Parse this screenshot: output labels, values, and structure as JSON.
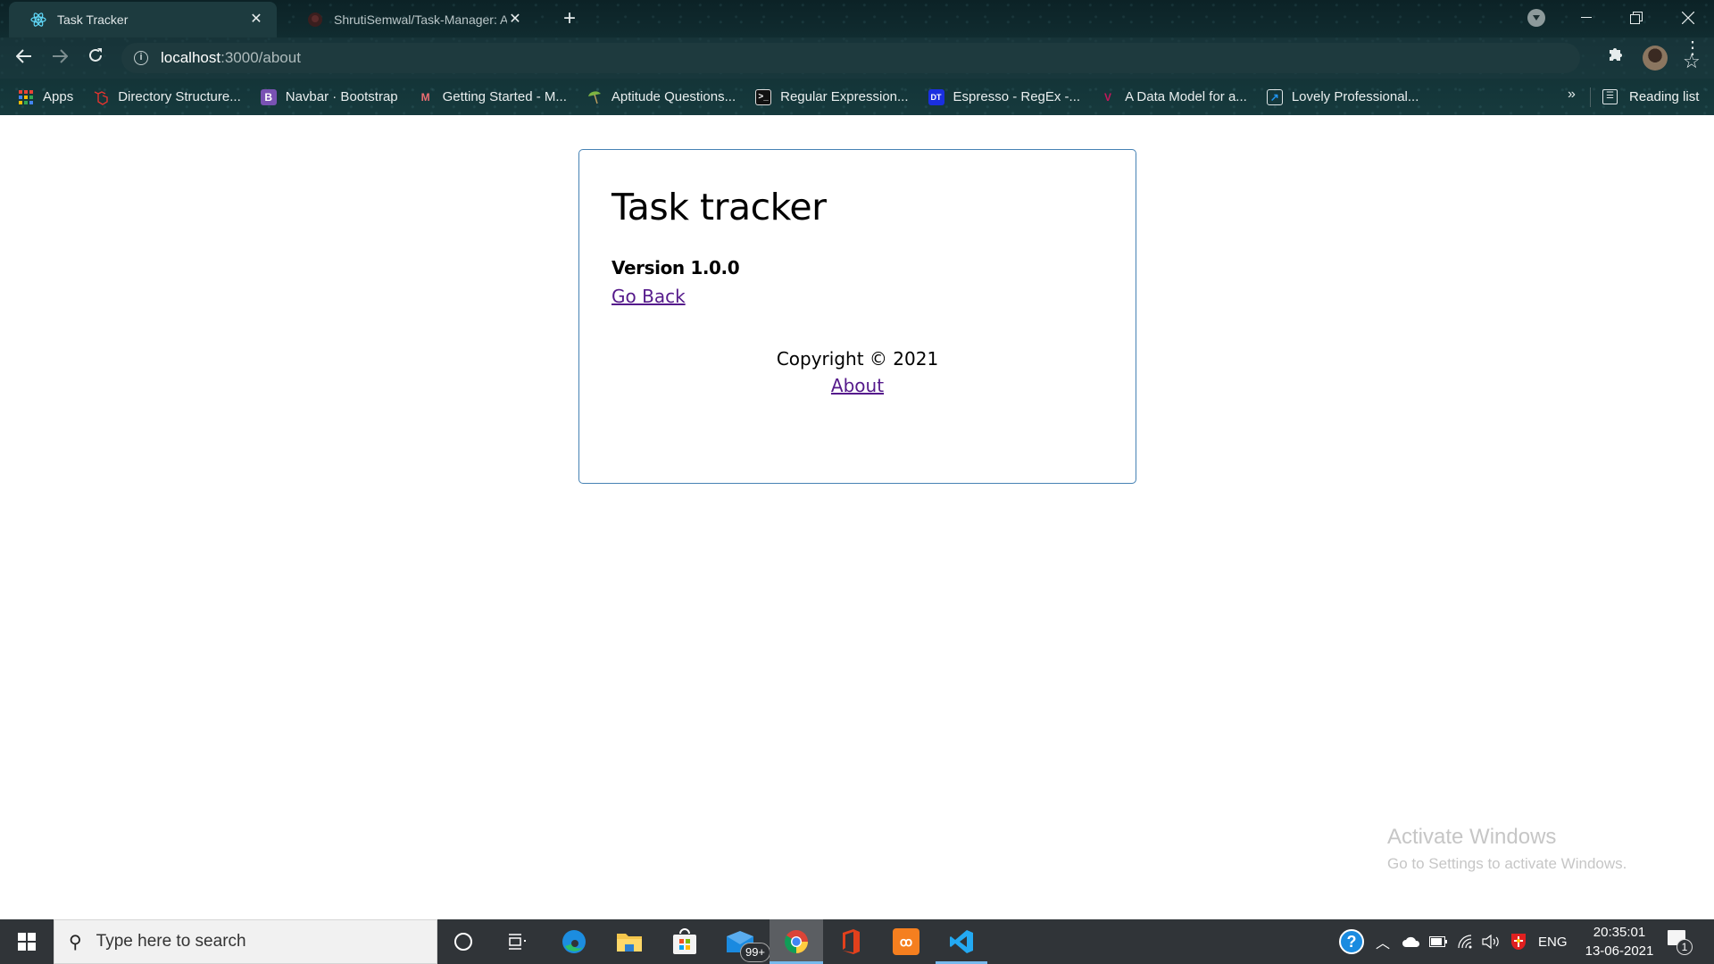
{
  "browser": {
    "tabs": [
      {
        "title": "Task Tracker",
        "icon": "react-icon",
        "active": true
      },
      {
        "title": "ShrutiSemwal/Task-Manager: An",
        "icon": "github-icon",
        "active": false
      }
    ],
    "new_tab_label": "+",
    "url": {
      "host": "localhost",
      "rest": ":3000/about"
    },
    "bookmarks": [
      {
        "label": "Apps",
        "icon": "apps-grid-icon"
      },
      {
        "label": "Directory Structure...",
        "icon": "laravel-icon"
      },
      {
        "label": "Navbar · Bootstrap",
        "icon": "bootstrap-icon",
        "glyph": "B"
      },
      {
        "label": "Getting Started - M...",
        "icon": "materialize-icon",
        "glyph": "M"
      },
      {
        "label": "Aptitude Questions...",
        "icon": "umbrella-icon"
      },
      {
        "label": "Regular Expression...",
        "icon": "terminal-icon",
        "glyph": ">_"
      },
      {
        "label": "Espresso - RegEx -...",
        "icon": "danstools-icon",
        "glyph": "DT"
      },
      {
        "label": "A Data Model for a...",
        "icon": "vertabelo-icon",
        "glyph": "V"
      },
      {
        "label": "Lovely Professional...",
        "icon": "external-link-icon",
        "glyph": "↗"
      }
    ],
    "more_bookmarks": "»",
    "reading_list": "Reading list"
  },
  "page": {
    "title": "Task tracker",
    "version": "Version 1.0.0",
    "go_back": "Go Back",
    "footer": {
      "copyright": "Copyright © 2021",
      "about_link": "About"
    }
  },
  "watermark": {
    "line1": "Activate Windows",
    "line2": "Go to Settings to activate Windows."
  },
  "taskbar": {
    "search_placeholder": "Type here to search",
    "mail_badge": "99+",
    "language": "ENG",
    "time": "20:35:01",
    "date": "13-06-2021",
    "notification_count": "1"
  },
  "colors": {
    "card_border": "#4682b4",
    "link_visited": "#551a8b",
    "taskbar_bg": "#303438",
    "taskbar_accent": "#76b9ed"
  }
}
